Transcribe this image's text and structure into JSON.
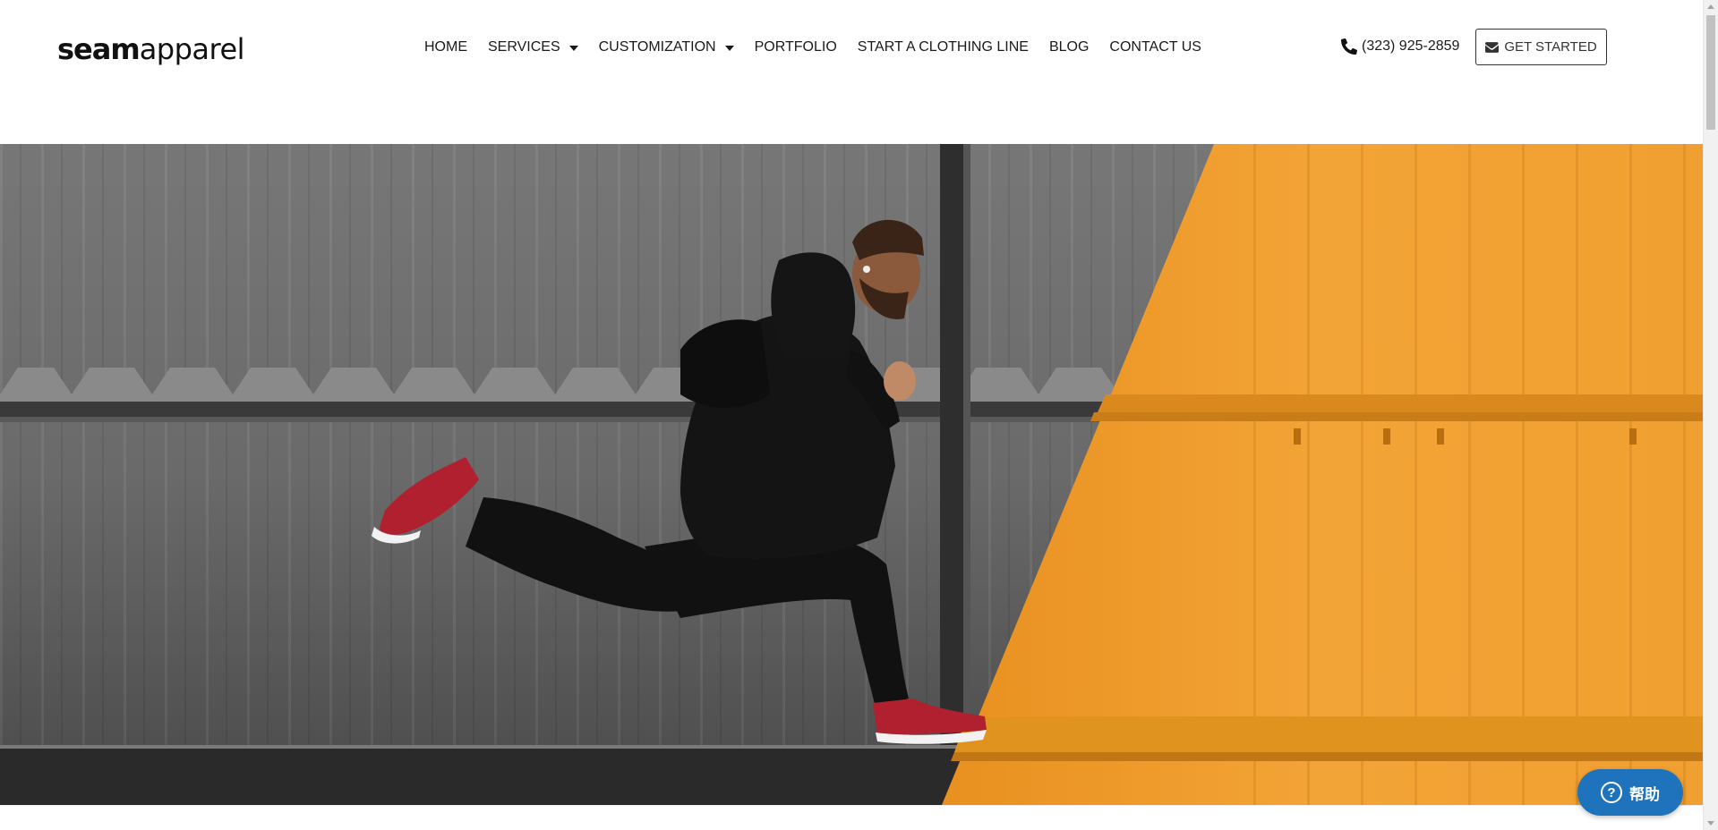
{
  "brand": {
    "logo_bold": "seam",
    "logo_light": "apparel"
  },
  "nav": {
    "items": [
      {
        "label": "HOME",
        "has_dropdown": false
      },
      {
        "label": "SERVICES",
        "has_dropdown": true
      },
      {
        "label": "CUSTOMIZATION",
        "has_dropdown": true
      },
      {
        "label": "PORTFOLIO",
        "has_dropdown": false
      },
      {
        "label": "START A CLOTHING LINE",
        "has_dropdown": false
      },
      {
        "label": "BLOG",
        "has_dropdown": false
      },
      {
        "label": "CONTACT US",
        "has_dropdown": false
      }
    ]
  },
  "contact": {
    "phone": "(323) 925-2859",
    "phone_icon": "phone-icon"
  },
  "cta": {
    "label": "GET STARTED",
    "icon": "envelope-icon"
  },
  "hero": {
    "image": "man-jumping-red-sneakers-gray-orange-wall",
    "colors": {
      "gray_wall": "#6e6e6e",
      "orange_wall": "#f0a030",
      "sneakers": "#b0202e",
      "outfit": "#111111"
    }
  },
  "help_widget": {
    "label": "帮助",
    "icon": "question-circle-icon",
    "color": "#1f73bd"
  }
}
